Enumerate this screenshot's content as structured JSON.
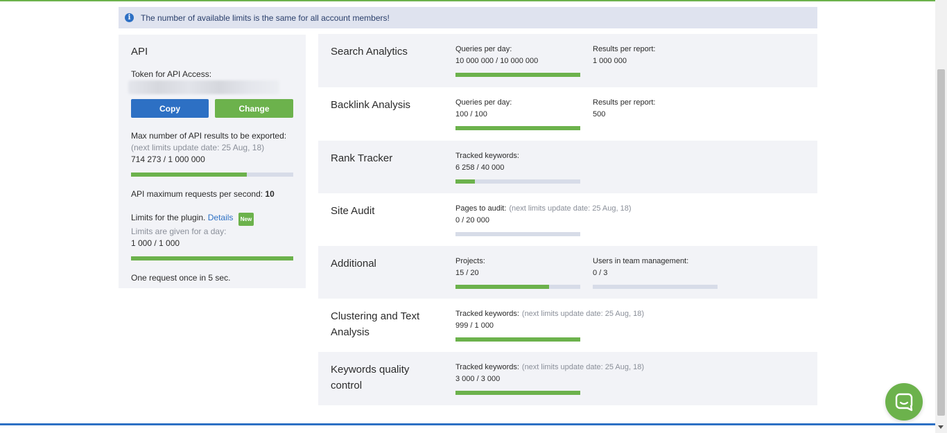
{
  "notice": {
    "icon": "info-icon",
    "text": "The number of available limits is the same for all account members!"
  },
  "api": {
    "title": "API",
    "token_label": "Token for API Access:",
    "copy_label": "Copy",
    "change_label": "Change",
    "export_label": "Max number of API results to be exported:",
    "export_note": "(next limits update date: 25 Aug, 18)",
    "export_value": "714 273 / 1 000 000",
    "export_fraction": 0.714,
    "rps_label": "API maximum requests per second:",
    "rps_value": "10",
    "plugin_label": "Limits for the plugin.",
    "plugin_link": "Details",
    "plugin_badge": "New",
    "plugin_note": "Limits are given for a day:",
    "plugin_value": "1 000 / 1 000",
    "plugin_fraction": 1.0,
    "request_note": "One request once in 5 sec."
  },
  "sections": [
    {
      "title": "Search Analytics",
      "metrics": [
        {
          "label": "Queries per day:",
          "value": "10 000 000 / 10 000 000",
          "fraction": 1.0
        },
        {
          "label": "Results per report:",
          "value": "1 000 000"
        }
      ]
    },
    {
      "title": "Backlink Analysis",
      "metrics": [
        {
          "label": "Queries per day:",
          "value": "100 / 100",
          "fraction": 1.0
        },
        {
          "label": "Results per report:",
          "value": "500"
        }
      ]
    },
    {
      "title": "Rank Tracker",
      "metrics": [
        {
          "label": "Tracked keywords:",
          "value": "6 258 / 40 000",
          "fraction": 0.156
        }
      ]
    },
    {
      "title": "Site Audit",
      "metrics": [
        {
          "label": "Pages to audit:",
          "note": "(next limits update date: 25 Aug, 18)",
          "value": "0 / 20 000",
          "fraction": 0.0
        }
      ]
    },
    {
      "title": "Additional",
      "metrics": [
        {
          "label": "Projects:",
          "value": "15 / 20",
          "fraction": 0.75
        },
        {
          "label": "Users in team management:",
          "value": "0 / 3",
          "fraction": 0.0
        }
      ]
    },
    {
      "title": "Clustering and Text Analysis",
      "metrics": [
        {
          "label": "Tracked keywords:",
          "note": "(next limits update date: 25 Aug, 18)",
          "value": "999 / 1 000",
          "fraction": 0.999
        }
      ]
    },
    {
      "title": "Keywords quality control",
      "metrics": [
        {
          "label": "Tracked keywords:",
          "note": "(next limits update date: 25 Aug, 18)",
          "value": "3 000 / 3 000",
          "fraction": 1.0
        }
      ]
    }
  ],
  "chat": {
    "icon": "chat-icon"
  },
  "colors": {
    "accent_green": "#6cb24c",
    "accent_blue": "#2d70c4",
    "track": "#d7dce8"
  }
}
